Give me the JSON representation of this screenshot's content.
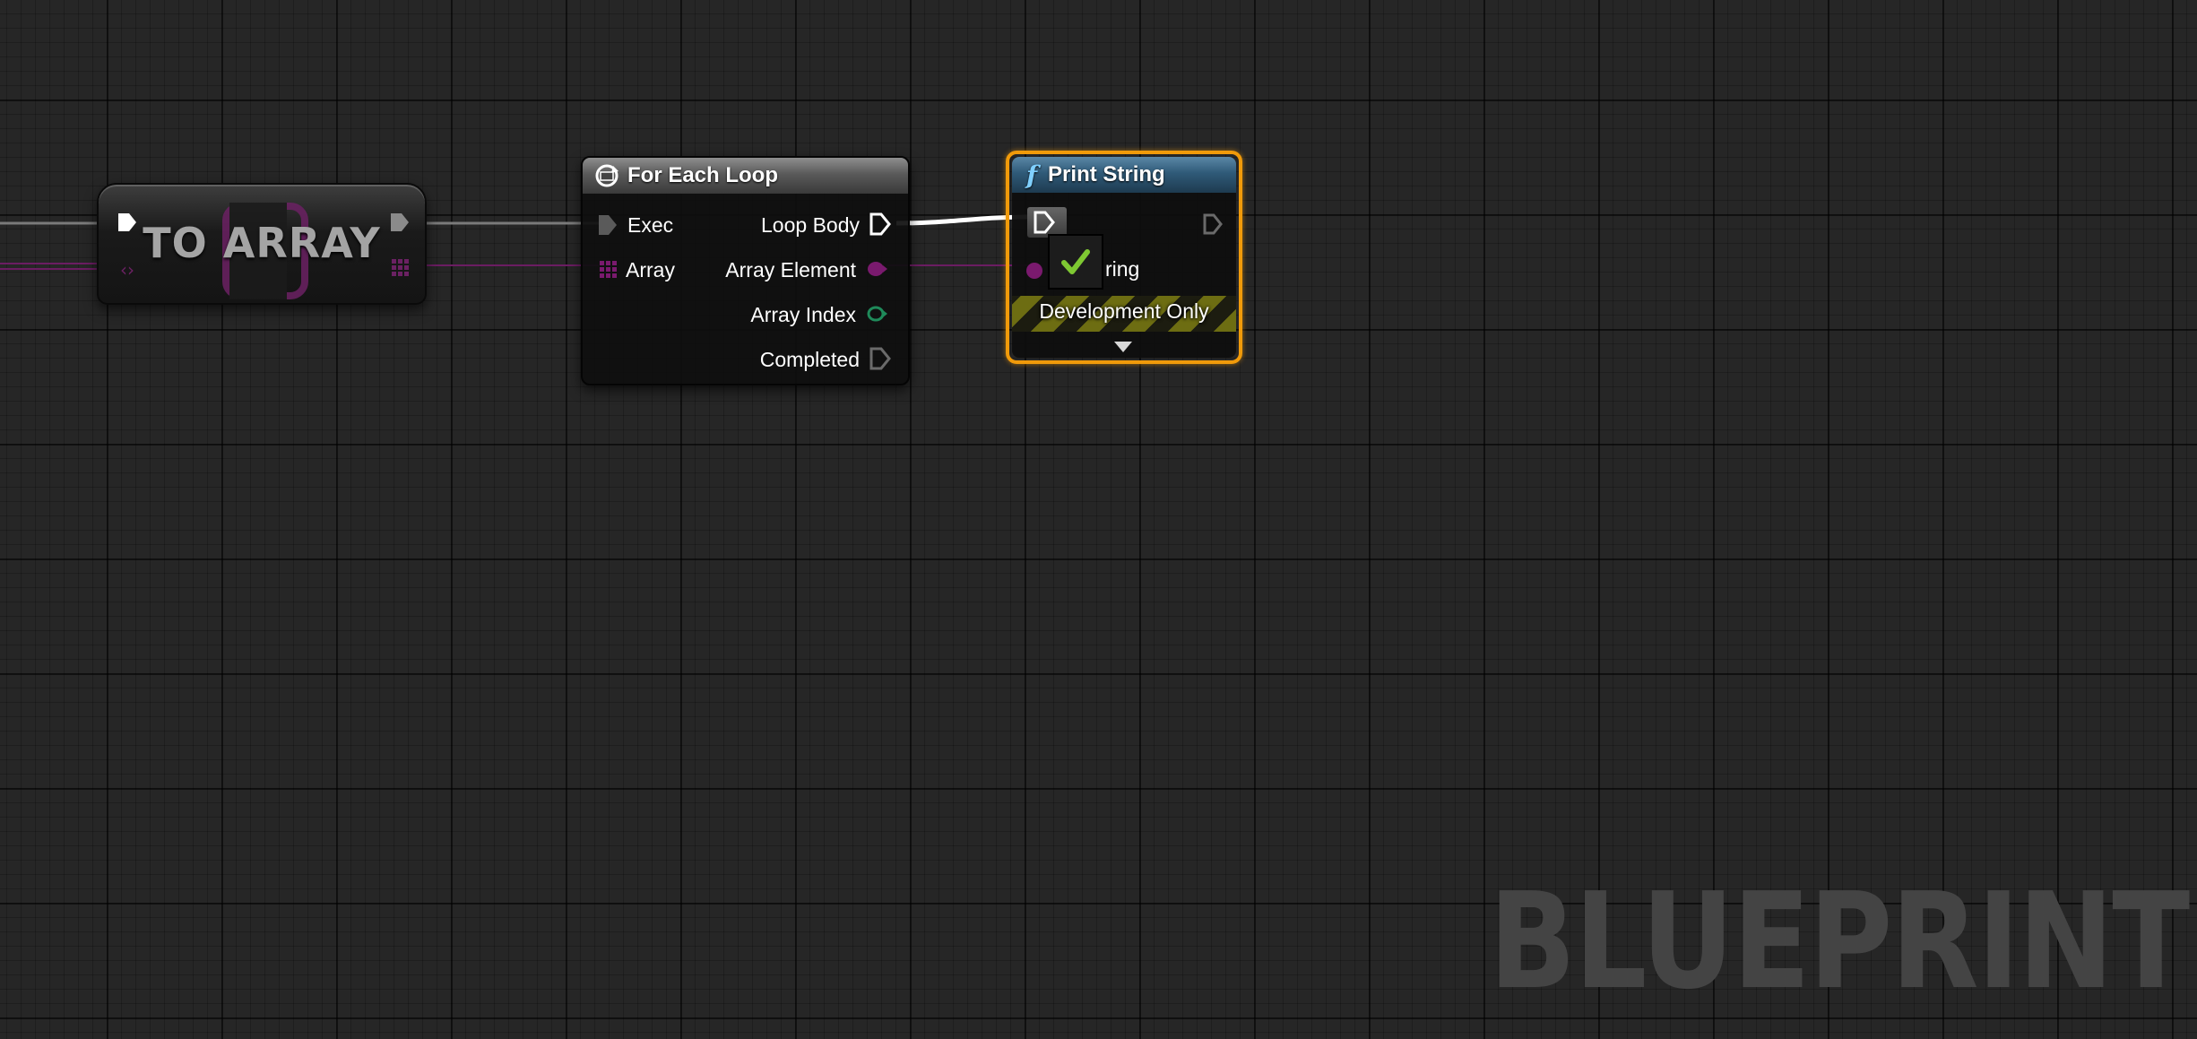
{
  "graph": {
    "watermark": "BLUEPRINT"
  },
  "to_array_node": {
    "title": "TO ARRAY"
  },
  "for_each_loop_node": {
    "title": "For Each Loop",
    "inputs": [
      "Exec",
      "Array"
    ],
    "outputs": [
      "Loop Body",
      "Array Element",
      "Array Index",
      "Completed"
    ]
  },
  "print_string_node": {
    "title": "Print String",
    "input_label": "ring",
    "development_only": "Development Only",
    "selected": true
  },
  "colors": {
    "exec": "#ffffff",
    "array_pin": "#7a1a6e",
    "int_pin": "#1f8a5a",
    "selection": "#f09a0a"
  },
  "icons": [
    "loop-icon",
    "function-icon",
    "checkmark-icon",
    "expand-arrow-icon"
  ]
}
